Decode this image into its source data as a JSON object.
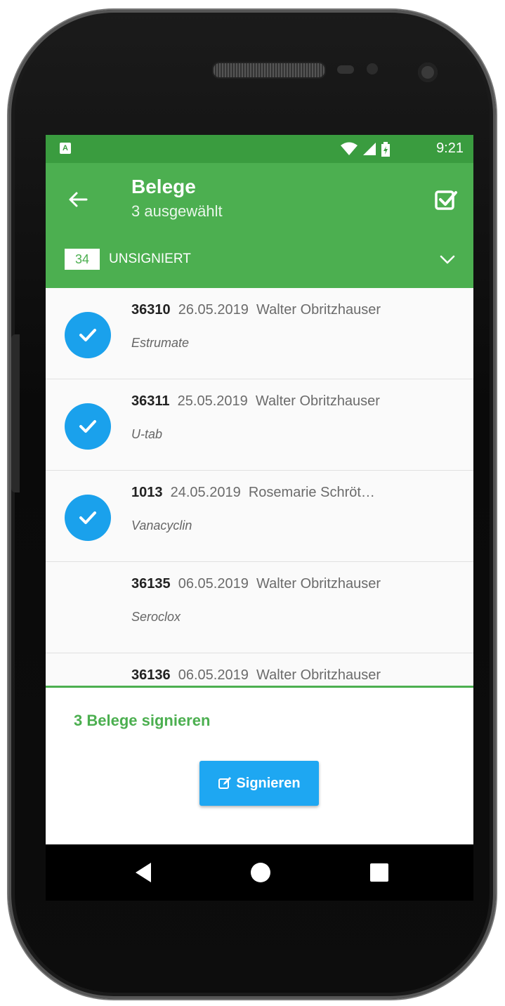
{
  "status_bar": {
    "app_badge": "A",
    "time": "9:21"
  },
  "app_bar": {
    "title": "Belege",
    "subtitle": "3 ausgewählt"
  },
  "filter": {
    "count": "34",
    "label": "UNSIGNIERT"
  },
  "items": [
    {
      "number": "36310",
      "date": "26.05.2019",
      "name": "Walter Obritzhauser",
      "product": "Estrumate",
      "selected": true
    },
    {
      "number": "36311",
      "date": "25.05.2019",
      "name": "Walter Obritzhauser",
      "product": "U-tab",
      "selected": true
    },
    {
      "number": "1013",
      "date": "24.05.2019",
      "name": "Rosemarie Schröt…",
      "product": "Vanacyclin",
      "selected": true
    },
    {
      "number": "36135",
      "date": "06.05.2019",
      "name": "Walter Obritzhauser",
      "product": "Seroclox",
      "selected": false
    },
    {
      "number": "36136",
      "date": "06.05.2019",
      "name": "Walter Obritzhauser",
      "product": "",
      "selected": false
    }
  ],
  "footer": {
    "summary": "3 Belege signieren",
    "button_label": "Signieren"
  },
  "colors": {
    "primary": "#4caf50",
    "status_bar": "#3a9c3f",
    "accent": "#1aa1ec"
  }
}
